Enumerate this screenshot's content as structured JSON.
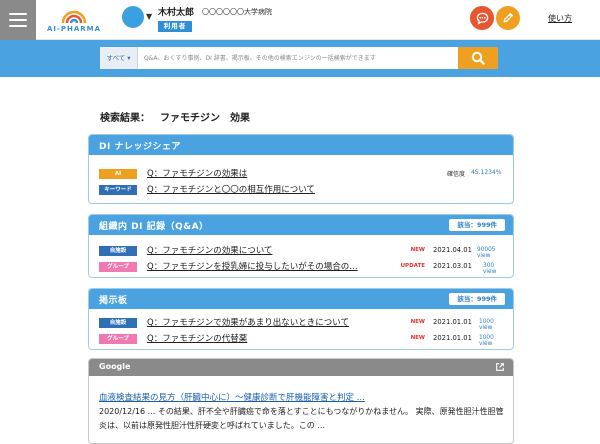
{
  "header": {
    "logo_text": "AI-PHARMA",
    "user_name": "木村太郎",
    "org_name": "〇〇〇〇〇〇大学病院",
    "role_badge": "利用者",
    "help_label": "使い方"
  },
  "search": {
    "scope": "すべて ▾",
    "placeholder": "Q&A、おくすり事例、DI 辞書、掲示板、その他の検索エンジンの一括検索ができます"
  },
  "results": {
    "label": "検索結果：",
    "query": "ファモチジン　効果"
  },
  "di_knowledge": {
    "title": "DI ナレッジシェア",
    "rows": [
      {
        "tag": "AI",
        "question": "Q：ファモチジンの効果は",
        "reliability_label": "確信度",
        "reliability_value": "45.1234%"
      },
      {
        "tag": "キーワード",
        "question": "Q：ファモチジンと〇〇の相互作用について"
      }
    ]
  },
  "org_di": {
    "title": "組織内 DI 記録（Q&A）",
    "count": "該当：999件",
    "rows": [
      {
        "tag": "自施設",
        "question": "Q：ファモチジンの効果について",
        "flag": "NEW",
        "date": "2021.04.01",
        "views": "90005 view"
      },
      {
        "tag": "グループ",
        "question": "Q：ファモチジンを授乳婦に投与したいがその場合の…",
        "flag": "UPDATE",
        "date": "2021.03.01",
        "views": "300 view"
      }
    ]
  },
  "board": {
    "title": "掲示板",
    "count": "該当：999件",
    "rows": [
      {
        "tag": "自施設",
        "question": "Q：ファモチジンで効果があまり出ないときについて",
        "flag": "NEW",
        "date": "2021.01.01",
        "views": "1000 view"
      },
      {
        "tag": "グループ",
        "question": "Q：ファモチジンの代替薬",
        "flag": "NEW",
        "date": "2021.01.01",
        "views": "1000 view"
      }
    ]
  },
  "google": {
    "title": "Google",
    "result_title": "血液検査結果の見方（肝臓中心に）～健康診断で肝機能障害と判定 ...",
    "snippet": "2020/12/16 ... その結果、肝不全や肝臓癌で命を落とすことにもつながりかねません。 実際、原発性胆汁性胆管炎は、以前は原発性胆汁性肝硬変と呼ばれていました。この ..."
  },
  "colors": {
    "accent_blue": "#4aa3e0",
    "orange": "#f0a020",
    "red_orange": "#e8552f",
    "pink": "#f07ab0"
  }
}
